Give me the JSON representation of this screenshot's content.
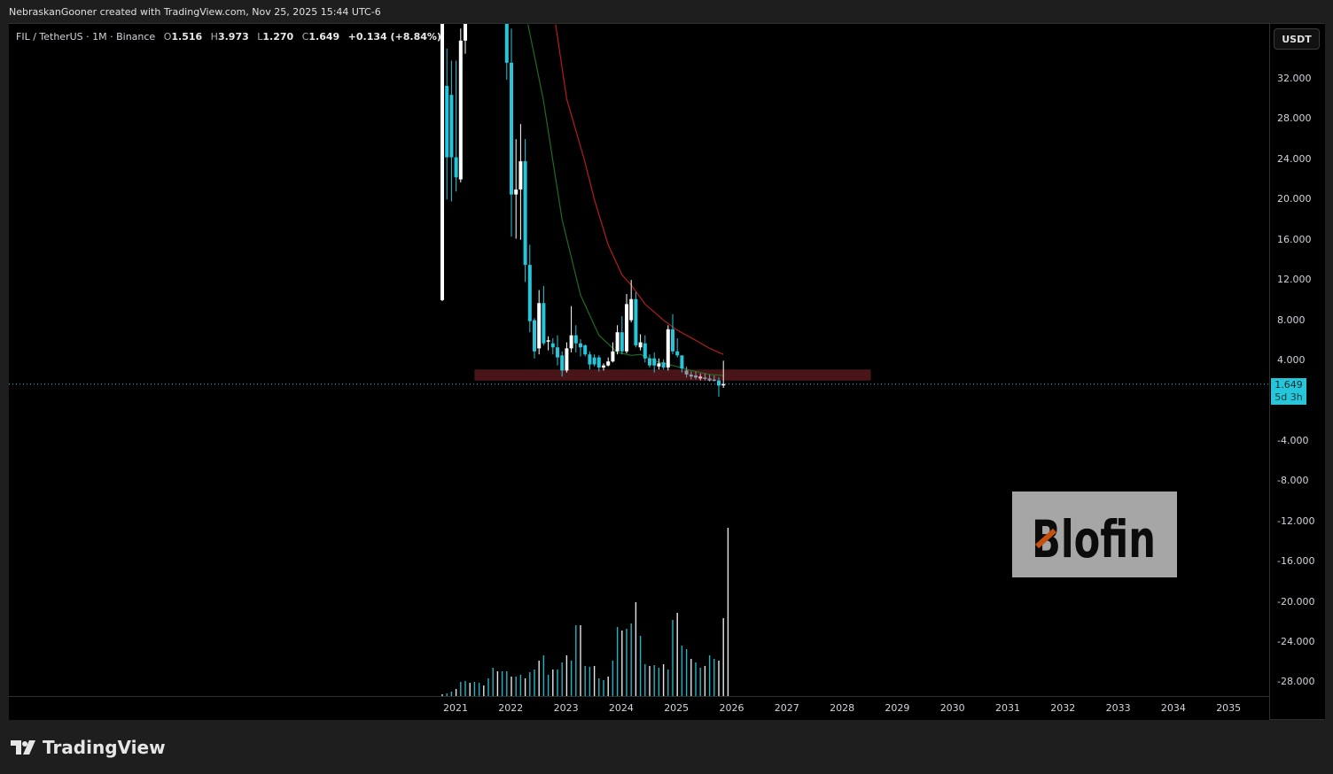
{
  "header": {
    "credit": "NebraskanGooner created with TradingView.com, Nov 25, 2025 15:44 UTC-6"
  },
  "legend": {
    "symbol": "FIL / TetherUS · 1M · Binance",
    "o_label": "O",
    "open": "1.516",
    "h_label": "H",
    "high": "3.973",
    "l_label": "L",
    "low": "1.270",
    "c_label": "C",
    "close": "1.649",
    "change": "+0.134 (+8.84%)"
  },
  "price_axis": {
    "currency": "USDT",
    "ticks": [
      "32.000",
      "28.000",
      "24.000",
      "20.000",
      "16.000",
      "12.000",
      "8.000",
      "4.000",
      "-4.000",
      "-8.000",
      "-12.000",
      "-16.000",
      "-20.000",
      "-24.000",
      "-28.000"
    ],
    "last_price": "1.649",
    "countdown": "5d 3h"
  },
  "time_axis": {
    "ticks": [
      "2021",
      "2022",
      "2023",
      "2024",
      "2025",
      "2026",
      "2027",
      "2028",
      "2029",
      "2030",
      "2031",
      "2032",
      "2033",
      "2034",
      "2035"
    ]
  },
  "watermark": {
    "text": "Blofin"
  },
  "footer": {
    "brand": "TradingView"
  },
  "colors": {
    "up": "#ffffff",
    "down": "#26c6da",
    "neutral": "#8a9aa8",
    "ma_fast": "#1f6b1f",
    "ma_slow": "#b71c1c",
    "zone": "#4a1518",
    "last_price_line": "#26c6da"
  },
  "chart_data": {
    "type": "candlestick",
    "symbol": "FILUSDT",
    "interval": "1M",
    "first_month": "2020-10",
    "ylim": [
      -30,
      37.4
    ],
    "candles": [
      {
        "i": 0,
        "o": 10,
        "h": 40,
        "l": 9.9,
        "c": 40
      },
      {
        "i": 1,
        "o": 31.3,
        "h": 35,
        "l": 20,
        "c": 24.2
      },
      {
        "i": 2,
        "o": 30.4,
        "h": 33.8,
        "l": 19.8,
        "c": 24.2
      },
      {
        "i": 3,
        "o": 24.2,
        "h": 33.8,
        "l": 20.8,
        "c": 22.2
      },
      {
        "i": 4,
        "o": 22,
        "h": 37,
        "l": 21.7,
        "c": 35.8
      },
      {
        "i": 5,
        "o": 35.8,
        "h": 40,
        "l": 34.5,
        "c": 40
      },
      {
        "i": 14,
        "o": 40,
        "h": 40,
        "l": 31.9,
        "c": 33.6
      },
      {
        "i": 15,
        "o": 33.6,
        "h": 37,
        "l": 16.3,
        "c": 20.5
      },
      {
        "i": 16,
        "o": 20.5,
        "h": 26,
        "l": 16.1,
        "c": 21.0
      },
      {
        "i": 17,
        "o": 21,
        "h": 27.5,
        "l": 16,
        "c": 23.8
      },
      {
        "i": 18,
        "o": 23.8,
        "h": 26,
        "l": 11.8,
        "c": 13.5
      },
      {
        "i": 19,
        "o": 13.5,
        "h": 15.5,
        "l": 6.8,
        "c": 7.9
      },
      {
        "i": 20,
        "o": 8,
        "h": 8.2,
        "l": 4.2,
        "c": 4.9
      },
      {
        "i": 21,
        "o": 5.2,
        "h": 11,
        "l": 4.6,
        "c": 9.7
      },
      {
        "i": 22,
        "o": 9.7,
        "h": 11.4,
        "l": 5.5,
        "c": 5.7
      },
      {
        "i": 23,
        "o": 5.9,
        "h": 6.4,
        "l": 5,
        "c": 6.0
      },
      {
        "i": 24,
        "o": 5.7,
        "h": 6.2,
        "l": 4.6,
        "c": 5.3
      },
      {
        "i": 25,
        "o": 5.3,
        "h": 6.5,
        "l": 3.5,
        "c": 4.3
      },
      {
        "i": 26,
        "o": 4.5,
        "h": 4.9,
        "l": 2.4,
        "c": 3.0
      },
      {
        "i": 27,
        "o": 3.0,
        "h": 5.8,
        "l": 2.8,
        "c": 5.2
      },
      {
        "i": 28,
        "o": 5.2,
        "h": 9.4,
        "l": 4.8,
        "c": 6.5
      },
      {
        "i": 29,
        "o": 6.5,
        "h": 7.5,
        "l": 4.8,
        "c": 5.7
      },
      {
        "i": 30,
        "o": 5.7,
        "h": 6.1,
        "l": 4.4,
        "c": 5.3
      },
      {
        "i": 31,
        "o": 5.5,
        "h": 5.6,
        "l": 4.4,
        "c": 4.6
      },
      {
        "i": 32,
        "o": 4.6,
        "h": 4.9,
        "l": 3.1,
        "c": 3.6
      },
      {
        "i": 33,
        "o": 4.3,
        "h": 4.6,
        "l": 3.4,
        "c": 3.6
      },
      {
        "i": 34,
        "o": 4.3,
        "h": 4.5,
        "l": 2.9,
        "c": 3.3
      },
      {
        "i": 35,
        "o": 3.3,
        "h": 3.7,
        "l": 3.0,
        "c": 3.5
      },
      {
        "i": 36,
        "o": 3.5,
        "h": 4.3,
        "l": 3.4,
        "c": 3.9
      },
      {
        "i": 37,
        "o": 3.9,
        "h": 5.8,
        "l": 3.8,
        "c": 4.9
      },
      {
        "i": 38,
        "o": 4.9,
        "h": 7.5,
        "l": 4.6,
        "c": 6.8
      },
      {
        "i": 39,
        "o": 6.8,
        "h": 8.4,
        "l": 4.6,
        "c": 4.9
      },
      {
        "i": 40,
        "o": 4.9,
        "h": 10.6,
        "l": 4.7,
        "c": 9.6
      },
      {
        "i": 41,
        "o": 8.0,
        "h": 12.0,
        "l": 7.8,
        "c": 10.1
      },
      {
        "i": 42,
        "o": 10.1,
        "h": 10.8,
        "l": 5.3,
        "c": 5.5
      },
      {
        "i": 43,
        "o": 5.3,
        "h": 6.6,
        "l": 5.0,
        "c": 5.8
      },
      {
        "i": 44,
        "o": 5.7,
        "h": 6.5,
        "l": 3.8,
        "c": 4.2
      },
      {
        "i": 45,
        "o": 4.2,
        "h": 4.6,
        "l": 3.3,
        "c": 3.5
      },
      {
        "i": 46,
        "o": 4.2,
        "h": 4.8,
        "l": 2.8,
        "c": 3.5
      },
      {
        "i": 47,
        "o": 3.4,
        "h": 4.2,
        "l": 3.1,
        "c": 3.7
      },
      {
        "i": 48,
        "o": 3.8,
        "h": 4.1,
        "l": 3.1,
        "c": 3.3
      },
      {
        "i": 49,
        "o": 3.3,
        "h": 7.5,
        "l": 3.0,
        "c": 7.1
      },
      {
        "i": 50,
        "o": 7.1,
        "h": 8.6,
        "l": 4.6,
        "c": 4.9
      },
      {
        "i": 51,
        "o": 4.9,
        "h": 6.2,
        "l": 4.3,
        "c": 4.5
      },
      {
        "i": 52,
        "o": 4.5,
        "h": 4.5,
        "l": 2.8,
        "c": 3.2
      },
      {
        "i": 53,
        "o": 3.0,
        "h": 3.4,
        "l": 2.3,
        "c": 2.6
      },
      {
        "i": 54,
        "o": 2.6,
        "h": 2.9,
        "l": 2.1,
        "c": 2.4
      },
      {
        "i": 55,
        "o": 2.5,
        "h": 2.9,
        "l": 2.1,
        "c": 2.3
      },
      {
        "i": 56,
        "o": 2.2,
        "h": 2.7,
        "l": 2.0,
        "c": 2.4
      },
      {
        "i": 57,
        "o": 2.3,
        "h": 2.7,
        "l": 2.0,
        "c": 2.2
      },
      {
        "i": 58,
        "o": 2.2,
        "h": 2.6,
        "l": 1.9,
        "c": 2.0
      },
      {
        "i": 59,
        "o": 2.1,
        "h": 2.5,
        "l": 1.9,
        "c": 2.0
      },
      {
        "i": 60,
        "o": 2.0,
        "h": 2.3,
        "l": 0.4,
        "c": 1.5
      },
      {
        "i": 61,
        "o": 1.516,
        "h": 3.973,
        "l": 1.27,
        "c": 1.649
      }
    ],
    "ma_fast": [
      [
        18.6,
        37.4
      ],
      [
        21.9,
        30
      ],
      [
        26,
        18
      ],
      [
        30,
        10.5
      ],
      [
        34,
        6.5
      ],
      [
        38,
        4.8
      ],
      [
        41,
        4.5
      ],
      [
        43,
        4.6
      ],
      [
        47,
        3.8
      ],
      [
        50,
        3.5
      ],
      [
        54,
        3.0
      ],
      [
        58,
        2.6
      ],
      [
        61,
        2.5
      ]
    ],
    "ma_slow": [
      [
        24.6,
        37.4
      ],
      [
        27,
        30
      ],
      [
        30.8,
        24
      ],
      [
        33,
        20
      ],
      [
        36,
        15.5
      ],
      [
        39,
        12.5
      ],
      [
        41,
        11.5
      ],
      [
        44,
        9.6
      ],
      [
        48,
        8.0
      ],
      [
        51,
        7.0
      ],
      [
        55,
        6.0
      ],
      [
        58,
        5.2
      ],
      [
        61,
        4.6
      ]
    ],
    "zone": {
      "from_index": 7,
      "to_index": 93,
      "top": 3.1,
      "bottom": 2.0
    },
    "volume_relative": [
      2,
      3,
      5,
      8,
      16,
      17,
      15,
      16,
      15,
      12,
      20,
      32,
      28,
      28,
      28,
      22,
      22,
      24,
      20,
      27,
      30,
      40,
      46,
      24,
      30,
      30,
      38,
      46,
      40,
      80,
      80,
      34,
      33,
      34,
      20,
      18,
      22,
      40,
      78,
      74,
      76,
      82,
      106,
      68,
      36,
      34,
      35,
      32,
      36,
      30,
      86,
      94,
      57,
      53,
      42,
      38,
      32,
      34,
      46,
      42,
      40,
      88,
      190
    ],
    "volume_first_index": 0
  }
}
